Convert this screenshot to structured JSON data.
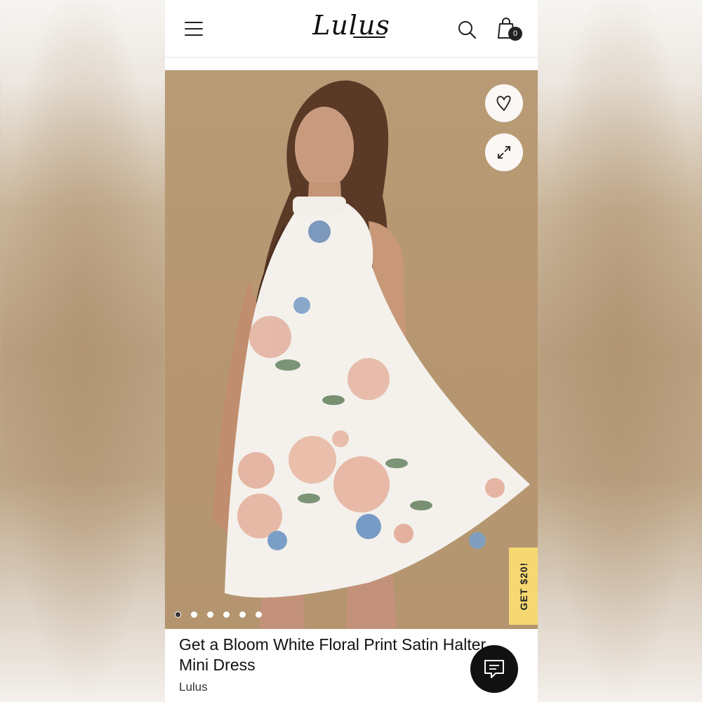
{
  "header": {
    "logo_text": "Lulus",
    "cart_count": "0"
  },
  "gallery": {
    "dots_total": 6,
    "active_index": 0,
    "promo_label": "GET $20!"
  },
  "product": {
    "title": "Get a Bloom White Floral Print Satin Halter Mini Dress",
    "brand": "Lulus"
  },
  "colors": {
    "background_tan": "#b69771",
    "promo_yellow": "#f6d872",
    "text_dark": "#111111"
  },
  "icons": [
    "menu-icon",
    "search-icon",
    "bag-icon",
    "heart-icon",
    "expand-icon",
    "chat-icon"
  ]
}
